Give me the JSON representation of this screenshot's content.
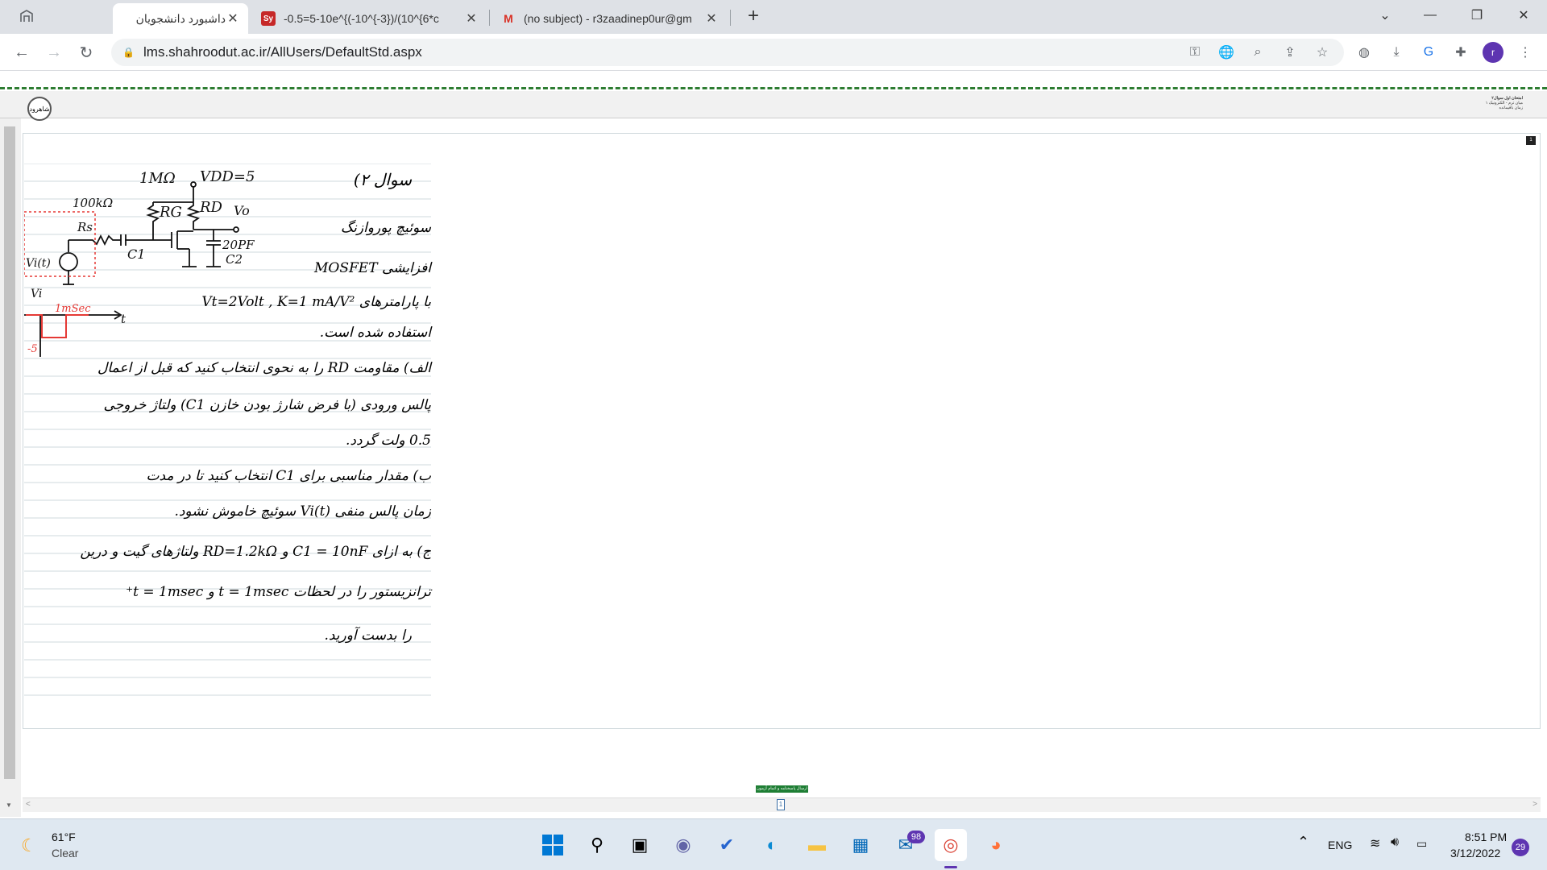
{
  "browser": {
    "tabs": [
      {
        "title": "داشبورد دانشجویان",
        "favicon": "lms-icon",
        "active": true
      },
      {
        "title": "-0.5=5-10e^{(-10^{-3})/(10^{6*c",
        "favicon": "symbolab-icon",
        "favicon_text": "Sy",
        "active": false
      },
      {
        "title": "(no subject) - r3zaadinep0ur@gm",
        "favicon": "gmail-icon",
        "favicon_text": "M",
        "active": false
      }
    ],
    "new_tab_label": "+",
    "url": "lms.shahroodut.ac.ir/AllUsers/DefaultStd.aspx"
  },
  "lms": {
    "logo_text": "شاهرود",
    "info_line1": "امتحان اول سوال۲",
    "info_line2": "میان ترم - الکترونیک ۱",
    "info_line3": "زمان باقیمانده",
    "page_badge": "1",
    "submit_label": "ارسال پاسخنامه و اتمام آزمون",
    "page_number": "1"
  },
  "question": {
    "title": "سوال ۲)",
    "circuit": {
      "r1": "1MΩ",
      "vdd": "VDD=5",
      "rg": "RG",
      "rd": "RD",
      "rs_val": "100kΩ",
      "rs": "Rs",
      "vo": "Vo",
      "c1": "C1",
      "c2": "C2",
      "c2_val": "20PF",
      "vi": "Vi(t)"
    },
    "pulse": {
      "vi_label": "Vi",
      "width_label": "1mSec",
      "t_label": "t",
      "amp_label": "-5"
    },
    "lines": [
      "سوئیچ پوروازنگ",
      "افزایشی MOSFET",
      "با پارامترهای Vt=2Volt , K=1 mA/V²",
      "استفاده شده است.",
      "الف) مقاومت RD را به نحوی انتخاب کنید که قبل از اعمال",
      "پالس ورودی (با فرض شارژ بودن خازن C1) ولتاژ خروجی",
      "0.5 ولت گردد.",
      "ب) مقدار مناسبی برای C1 انتخاب کنید تا در مدت",
      "زمان پالس منفی Vi(t) سوئیچ خاموش نشود.",
      "ج) به ازای C1 = 10nF و RD=1.2kΩ ولتاژهای گیت و درین",
      "ترانزیستور را در لحظات t = 1msec و t = 1msec⁺",
      "را بدست آورید."
    ]
  },
  "taskbar": {
    "weather_temp": "61°F",
    "weather_desc": "Clear",
    "mail_badge": "98",
    "lang": "ENG",
    "time": "8:51 PM",
    "date": "3/12/2022",
    "notif_badge": "29"
  },
  "colors": {
    "accent_green": "#2e7d32",
    "pulse_red": "#e53935",
    "taskbar": "#dfe8f1",
    "chrome_tab_bg": "#dee1e6"
  }
}
